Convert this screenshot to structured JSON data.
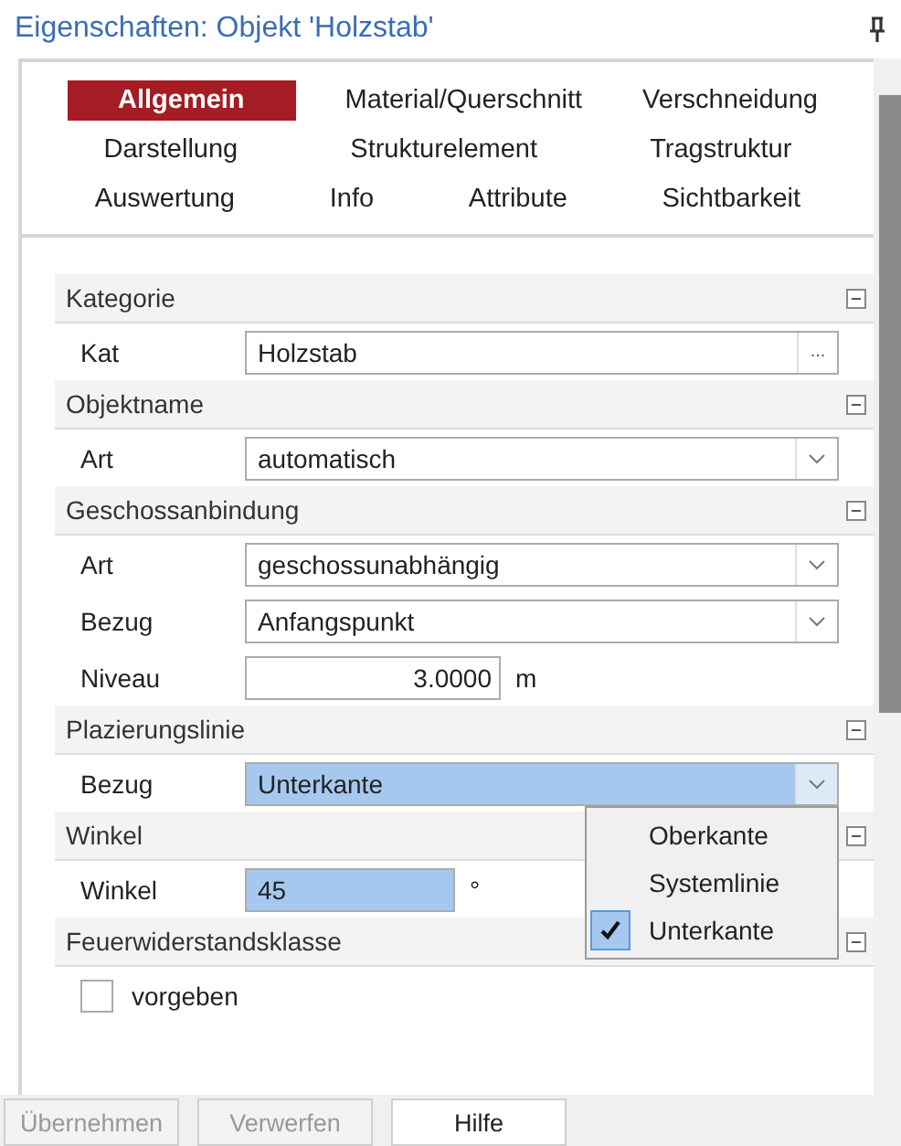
{
  "window": {
    "title": "Eigenschaften: Objekt 'Holzstab'"
  },
  "tab_rows": [
    [
      {
        "label": "Allgemein",
        "selected": true
      },
      {
        "label": "Material/Querschnitt",
        "selected": false
      },
      {
        "label": "Verschneidung",
        "selected": false
      }
    ],
    [
      {
        "label": "Darstellung",
        "selected": false
      },
      {
        "label": "Strukturelement",
        "selected": false
      },
      {
        "label": "Tragstruktur",
        "selected": false
      }
    ],
    [
      {
        "label": "Auswertung",
        "selected": false
      },
      {
        "label": "Info",
        "selected": false
      },
      {
        "label": "Attribute",
        "selected": false
      },
      {
        "label": "Sichtbarkeit",
        "selected": false
      }
    ]
  ],
  "sections": [
    {
      "title": "Kategorie",
      "expanded": true,
      "rows": [
        {
          "kind": "browse",
          "label": "Kat",
          "value": "Holzstab",
          "button": "..."
        }
      ]
    },
    {
      "title": "Objektname",
      "expanded": true,
      "rows": [
        {
          "kind": "select",
          "label": "Art",
          "value": "automatisch",
          "highlighted": false
        }
      ]
    },
    {
      "title": "Geschossanbindung",
      "expanded": true,
      "rows": [
        {
          "kind": "select",
          "label": "Art",
          "value": "geschossunabhängig",
          "highlighted": false
        },
        {
          "kind": "select",
          "label": "Bezug",
          "value": "Anfangspunkt",
          "highlighted": false
        },
        {
          "kind": "number",
          "label": "Niveau",
          "value": "3.0000",
          "unit": "m",
          "highlighted": false
        }
      ]
    },
    {
      "title": "Plazierungslinie",
      "expanded": true,
      "rows": [
        {
          "kind": "select",
          "label": "Bezug",
          "value": "Unterkante",
          "highlighted": true,
          "open": true
        }
      ]
    },
    {
      "title": "Winkel",
      "expanded": true,
      "rows": [
        {
          "kind": "number",
          "label": "Winkel",
          "value": "45",
          "unit": "°",
          "highlighted": true
        }
      ]
    },
    {
      "title": "Feuerwiderstandsklasse",
      "expanded": true,
      "rows": [
        {
          "kind": "checkbox",
          "label": "vorgeben",
          "checked": false
        }
      ]
    }
  ],
  "dropdown": {
    "items": [
      {
        "label": "Oberkante",
        "selected": false
      },
      {
        "label": "Systemlinie",
        "selected": false
      },
      {
        "label": "Unterkante",
        "selected": true
      }
    ]
  },
  "buttons": [
    {
      "label": "Übernehmen",
      "disabled": true
    },
    {
      "label": "Verwerfen",
      "disabled": true
    },
    {
      "label": "Hilfe",
      "disabled": false
    }
  ]
}
